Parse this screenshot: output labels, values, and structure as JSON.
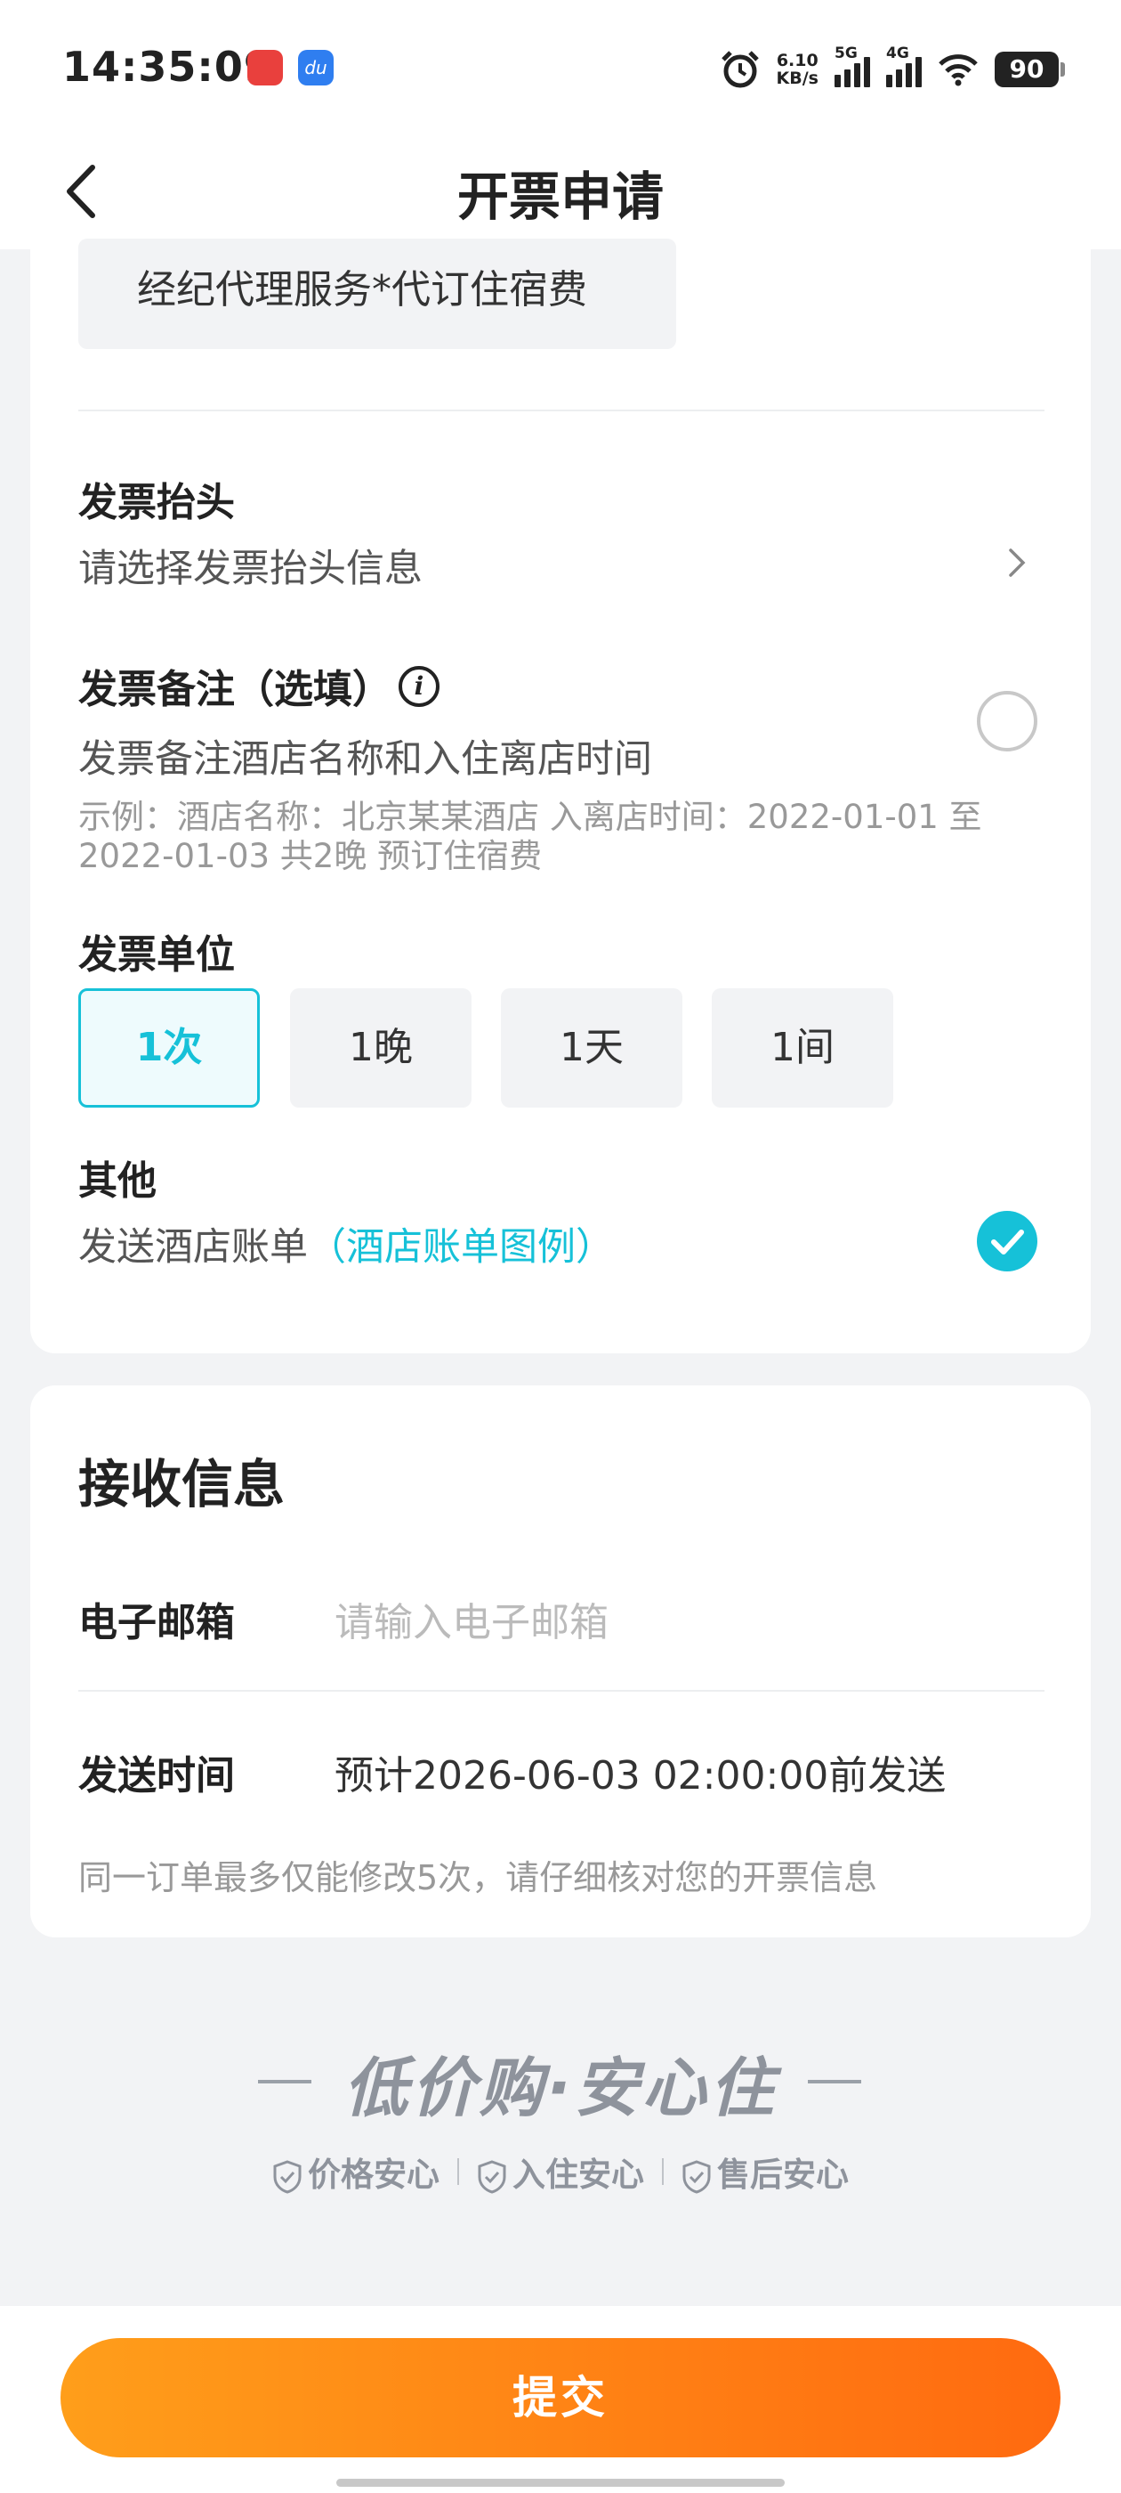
{
  "status_bar": {
    "time": "14:35:09",
    "net_speed_value": "6.10",
    "net_speed_unit": "KB/s",
    "sig1_label": "5G",
    "sig2_label": "4G",
    "battery": "90",
    "icons": [
      "alarm-icon",
      "signal-5g-icon",
      "signal-4g-icon",
      "wifi-icon",
      "battery-icon"
    ]
  },
  "nav": {
    "title": "开票申请"
  },
  "invoice": {
    "item_name": "经纪代理服务*代订住宿费",
    "header_label": "发票抬头",
    "header_placeholder": "请选择发票抬头信息",
    "remark_label": "发票备注（选填）",
    "remark_option": "发票备注酒店名称和入住离店时间",
    "remark_example": "示例：酒店名称：北京某某酒店 入离店时间：2022-01-01 至 2022-01-03 共2晚 预订住宿费",
    "unit_label": "发票单位",
    "units": [
      "1次",
      "1晚",
      "1天",
      "1间"
    ],
    "selected_unit": "1次",
    "other_label": "其他",
    "other_option": "发送酒店账单",
    "other_link": "（酒店账单图例）",
    "other_checked": true
  },
  "receive": {
    "title": "接收信息",
    "email_label": "电子邮箱",
    "email_placeholder": "请输入电子邮箱",
    "send_time_label": "发送时间",
    "send_time_value": "预计2026-06-03 02:00:00前发送",
    "note": "同一订单最多仅能修改5次，请仔细核对您的开票信息"
  },
  "slogan": {
    "text": "低价购·安心住",
    "assurances": [
      "价格安心",
      "入住安心",
      "售后安心"
    ]
  },
  "submit_label": "提交",
  "colors": {
    "accent": "#16c1d8",
    "submit_start": "#ff9e1a",
    "submit_end": "#ff6a10"
  }
}
